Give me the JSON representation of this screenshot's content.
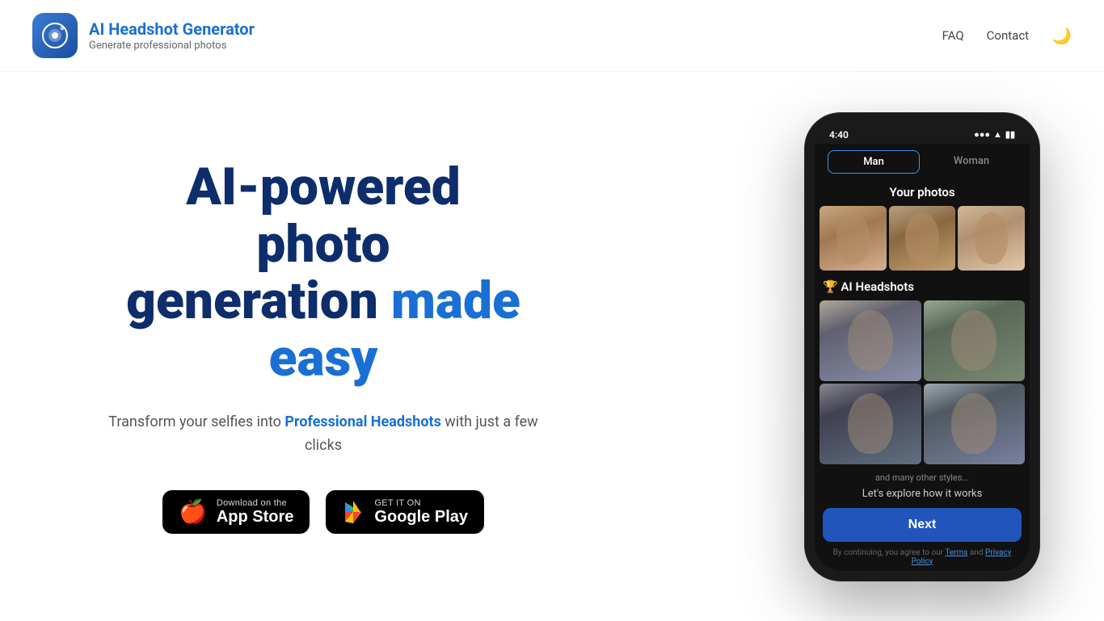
{
  "header": {
    "logo_title": "AI Headshot Generator",
    "logo_subtitle": "Generate professional photos",
    "nav_faq": "FAQ",
    "nav_contact": "Contact"
  },
  "hero": {
    "title_line1": "AI-powered",
    "title_line2": "photo",
    "title_line3": "generation",
    "title_line4": "made",
    "title_line5": "easy",
    "subtitle_prefix": "Transform your selfies into ",
    "subtitle_highlight": "Professional Headshots",
    "subtitle_suffix": " with just a few clicks"
  },
  "store_buttons": {
    "apple": {
      "top": "Download on the",
      "main": "App Store"
    },
    "google": {
      "top": "GET IT ON",
      "main": "Google Play"
    }
  },
  "phone": {
    "time": "4:40",
    "tab_man": "Man",
    "tab_woman": "Woman",
    "photos_heading": "Your photos",
    "ai_label": "🏆 AI Headshots",
    "more_styles": "and many other styles...",
    "explore": "Let's explore how it works",
    "next_btn": "Next",
    "terms": "By continuing, you agree to our Terms and Privacy Policy"
  }
}
